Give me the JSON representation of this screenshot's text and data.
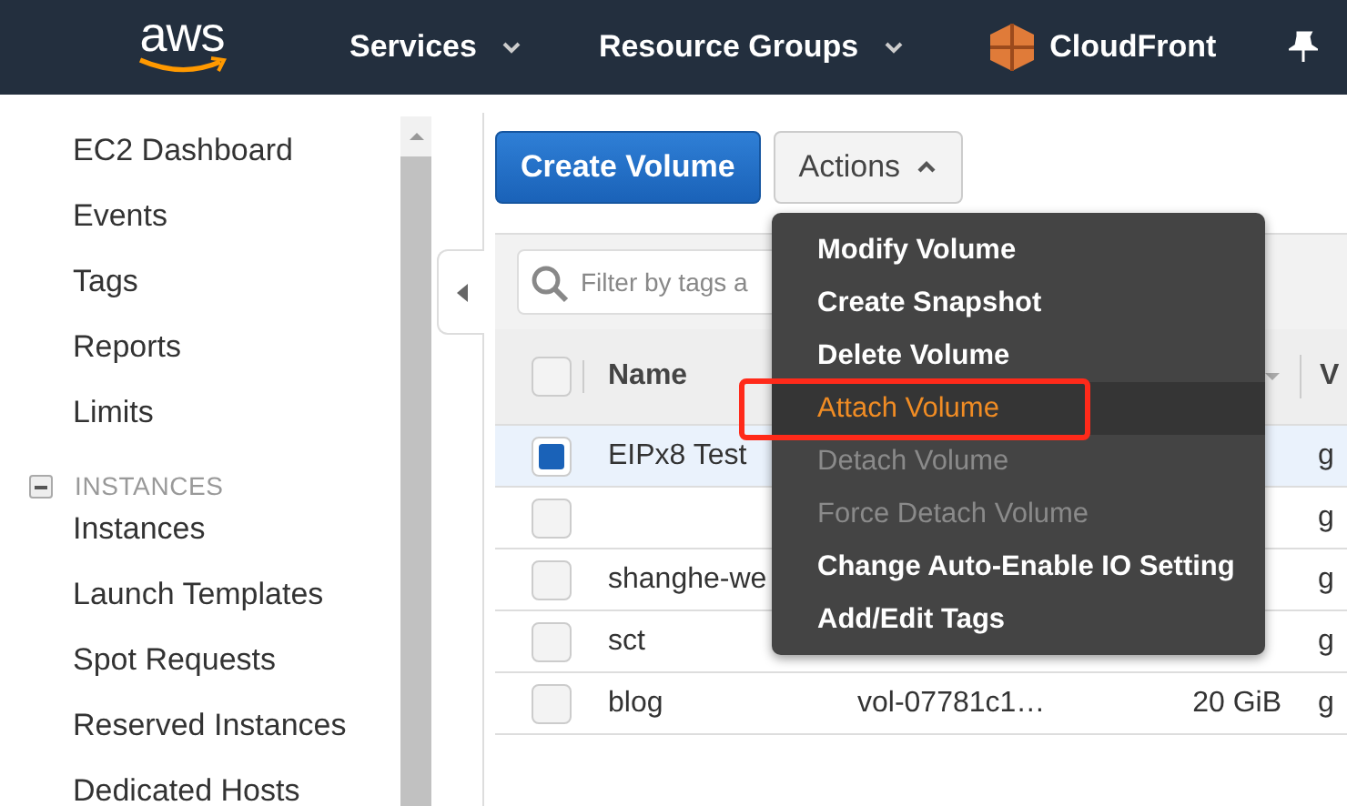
{
  "navbar": {
    "logo": "aws",
    "menus": [
      {
        "label": "Services"
      },
      {
        "label": "Resource Groups"
      }
    ],
    "service": "CloudFront"
  },
  "sidebar": {
    "items": [
      {
        "label": "EC2 Dashboard"
      },
      {
        "label": "Events"
      },
      {
        "label": "Tags"
      },
      {
        "label": "Reports"
      },
      {
        "label": "Limits"
      }
    ],
    "sections": [
      {
        "title": "INSTANCES",
        "expanded": true,
        "items": [
          {
            "label": "Instances"
          },
          {
            "label": "Launch Templates"
          },
          {
            "label": "Spot Requests"
          },
          {
            "label": "Reserved Instances"
          },
          {
            "label": "Dedicated Hosts"
          }
        ]
      }
    ]
  },
  "toolbar": {
    "primary": "Create Volume",
    "actions": "Actions",
    "actions_open": true
  },
  "filter": {
    "placeholder": "Filter by tags a"
  },
  "table": {
    "select_all": false,
    "columns": [
      "Name",
      "",
      "",
      "V"
    ],
    "rows": [
      {
        "selected": true,
        "cells": [
          "EIPx8 Test",
          "",
          "",
          "g"
        ]
      },
      {
        "selected": false,
        "cells": [
          "",
          "",
          "",
          "g"
        ]
      },
      {
        "selected": false,
        "cells": [
          "shanghe-we",
          "",
          "",
          "g"
        ]
      },
      {
        "selected": false,
        "cells": [
          "sct",
          "",
          "",
          "g"
        ]
      },
      {
        "selected": false,
        "cells": [
          "blog",
          "vol-07781c1…",
          "20 GiB",
          "g"
        ]
      }
    ]
  },
  "menu": [
    {
      "label": "Modify Volume",
      "disabled": false,
      "highlighted": false
    },
    {
      "label": "Create Snapshot",
      "disabled": false,
      "highlighted": false
    },
    {
      "label": "Delete Volume",
      "disabled": false,
      "highlighted": false
    },
    {
      "label": "Attach Volume",
      "disabled": false,
      "highlighted": true
    },
    {
      "label": "Detach Volume",
      "disabled": true,
      "highlighted": false
    },
    {
      "label": "Force Detach Volume",
      "disabled": true,
      "highlighted": false
    },
    {
      "label": "Change Auto-Enable IO Setting",
      "disabled": false,
      "highlighted": false
    },
    {
      "label": "Add/Edit Tags",
      "disabled": false,
      "highlighted": false
    }
  ]
}
